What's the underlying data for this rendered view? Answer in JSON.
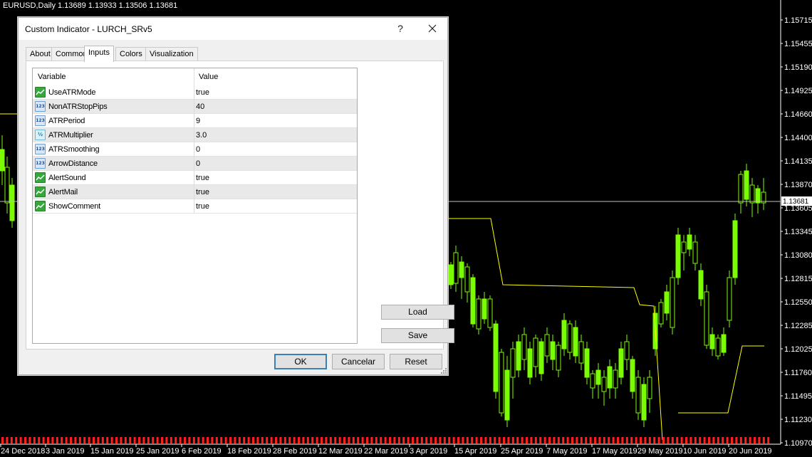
{
  "chart": {
    "header_text": "EURUSD,Daily  1.13689 1.13933 1.13506 1.13681",
    "current_price_label": "1.13681",
    "price_labels": [
      "1.15715",
      "1.15455",
      "1.15190",
      "1.14925",
      "1.14660",
      "1.14400",
      "1.14135",
      "1.13870",
      "1.13605",
      "1.13345",
      "1.13080",
      "1.12815",
      "1.12550",
      "1.12285",
      "1.12025",
      "1.11760",
      "1.11495",
      "1.11230",
      "1.10970"
    ],
    "date_labels": [
      "24 Dec 2018",
      "3 Jan 2019",
      "15 Jan 2019",
      "25 Jan 2019",
      "6 Feb 2019",
      "18 Feb 2019",
      "28 Feb 2019",
      "12 Mar 2019",
      "22 Mar 2019",
      "3 Apr 2019",
      "15 Apr 2019",
      "25 Apr 2019",
      "7 May 2019",
      "17 May 2019",
      "29 May 2019",
      "10 Jun 2019",
      "20 Jun 2019"
    ],
    "colors": {
      "background": "#000000",
      "candle": "#7cfc00",
      "indicator": "#ffff00",
      "markers": "#ff2020",
      "axis": "#ffffff"
    }
  },
  "dialog": {
    "title": "Custom Indicator - LURCH_SRv5",
    "help_label": "?",
    "close_icon": "close-icon",
    "tabs": [
      {
        "label": "About",
        "active": false
      },
      {
        "label": "Common",
        "active": false
      },
      {
        "label": "Inputs",
        "active": true
      },
      {
        "label": "Colors",
        "active": false
      },
      {
        "label": "Visualization",
        "active": false
      }
    ],
    "grid": {
      "columns": [
        "Variable",
        "Value"
      ],
      "rows": [
        {
          "icon": "bool",
          "name": "UseATRMode",
          "value": "true"
        },
        {
          "icon": "int",
          "name": "NonATRStopPips",
          "value": "40"
        },
        {
          "icon": "int",
          "name": "ATRPeriod",
          "value": "9"
        },
        {
          "icon": "double",
          "name": "ATRMultiplier",
          "value": "3.0"
        },
        {
          "icon": "int",
          "name": "ATRSmoothing",
          "value": "0"
        },
        {
          "icon": "int",
          "name": "ArrowDistance",
          "value": "0"
        },
        {
          "icon": "bool",
          "name": "AlertSound",
          "value": "true"
        },
        {
          "icon": "bool",
          "name": "AlertMail",
          "value": "true"
        },
        {
          "icon": "bool",
          "name": "ShowComment",
          "value": "true"
        }
      ]
    },
    "buttons": {
      "load": "Load",
      "save": "Save",
      "ok": "OK",
      "cancel": "Cancelar",
      "reset": "Reset"
    },
    "icon_glyphs": {
      "int": "123",
      "double": "½"
    }
  }
}
